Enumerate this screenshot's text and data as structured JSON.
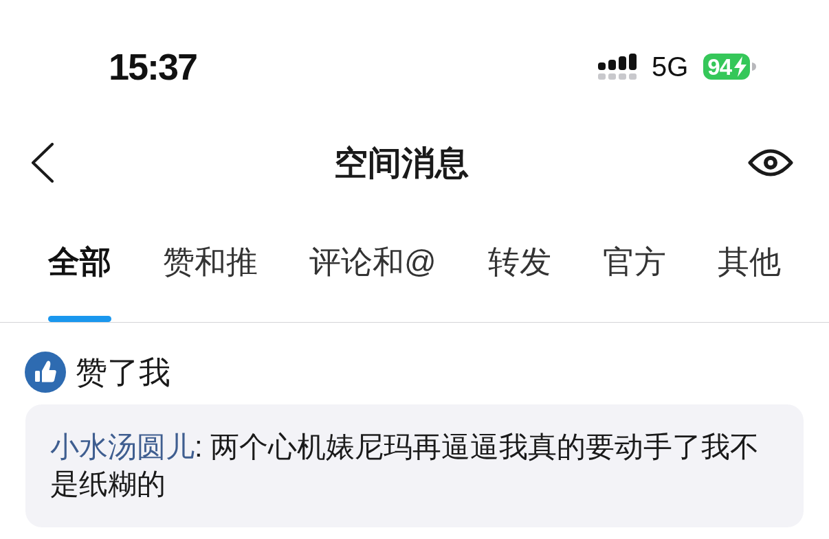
{
  "status_bar": {
    "time": "15:37",
    "network": "5G",
    "battery": "94",
    "charging": true
  },
  "header": {
    "title": "空间消息"
  },
  "tabs": [
    {
      "label": "全部",
      "selected": true
    },
    {
      "label": "赞和推",
      "selected": false
    },
    {
      "label": "评论和@",
      "selected": false
    },
    {
      "label": "转发",
      "selected": false
    },
    {
      "label": "官方",
      "selected": false
    },
    {
      "label": "其他",
      "selected": false
    }
  ],
  "notification": {
    "label": "赞了我",
    "comment": {
      "author": "小水汤圆儿",
      "text": ": 两个心机婊尼玛再逼逼我真的要动手了我不是纸糊的"
    }
  }
}
